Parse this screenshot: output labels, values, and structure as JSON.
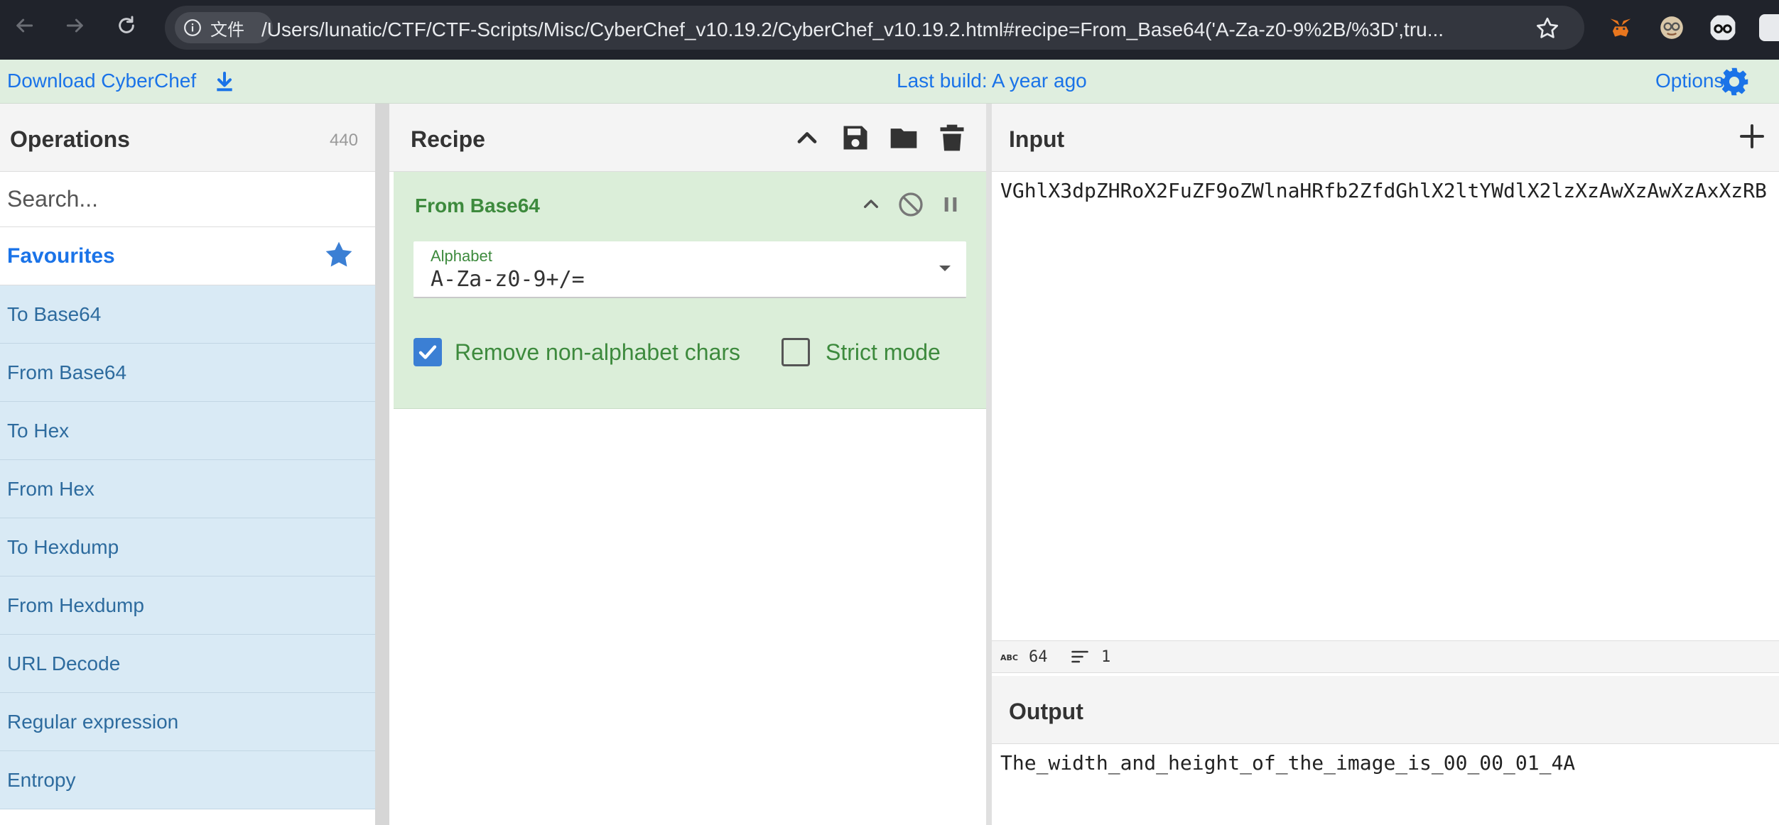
{
  "browser": {
    "site_chip_label": "文件",
    "url": "/Users/lunatic/CTF/CTF-Scripts/Misc/CyberChef_v10.19.2/CyberChef_v10.19.2.html#recipe=From_Base64('A-Za-z0-9%2B/%3D',tru..."
  },
  "banner": {
    "download_label": "Download CyberChef",
    "build_label": "Last build: A year ago",
    "options_label": "Options"
  },
  "operations": {
    "title": "Operations",
    "count": "440",
    "search_placeholder": "Search...",
    "favourites_label": "Favourites",
    "items": [
      "To Base64",
      "From Base64",
      "To Hex",
      "From Hex",
      "To Hexdump",
      "From Hexdump",
      "URL Decode",
      "Regular expression",
      "Entropy"
    ]
  },
  "recipe": {
    "title": "Recipe",
    "operation": {
      "name": "From Base64",
      "alphabet_label": "Alphabet",
      "alphabet_value": "A-Za-z0-9+/=",
      "remove_non_alpha_label": "Remove non-alphabet chars",
      "remove_non_alpha_checked": true,
      "strict_mode_label": "Strict mode",
      "strict_mode_checked": false
    }
  },
  "input": {
    "title": "Input",
    "text": "VGhlX3dpZHRoX2FuZF9oZWlnaHRfb2ZfdGhlX2ltYWdlX2lzXzAwXzAwXzAxXzRB",
    "length": "64",
    "lines": "1"
  },
  "output": {
    "title": "Output",
    "text": "The_width_and_height_of_the_image_is_00_00_01_4A"
  },
  "colors": {
    "banner_bg": "#dfeedf",
    "link_blue": "#1a73e8",
    "op_item_bg": "#d9eaf5",
    "recipe_card_bg": "#dbeed9",
    "recipe_green": "#3d8a3d"
  }
}
